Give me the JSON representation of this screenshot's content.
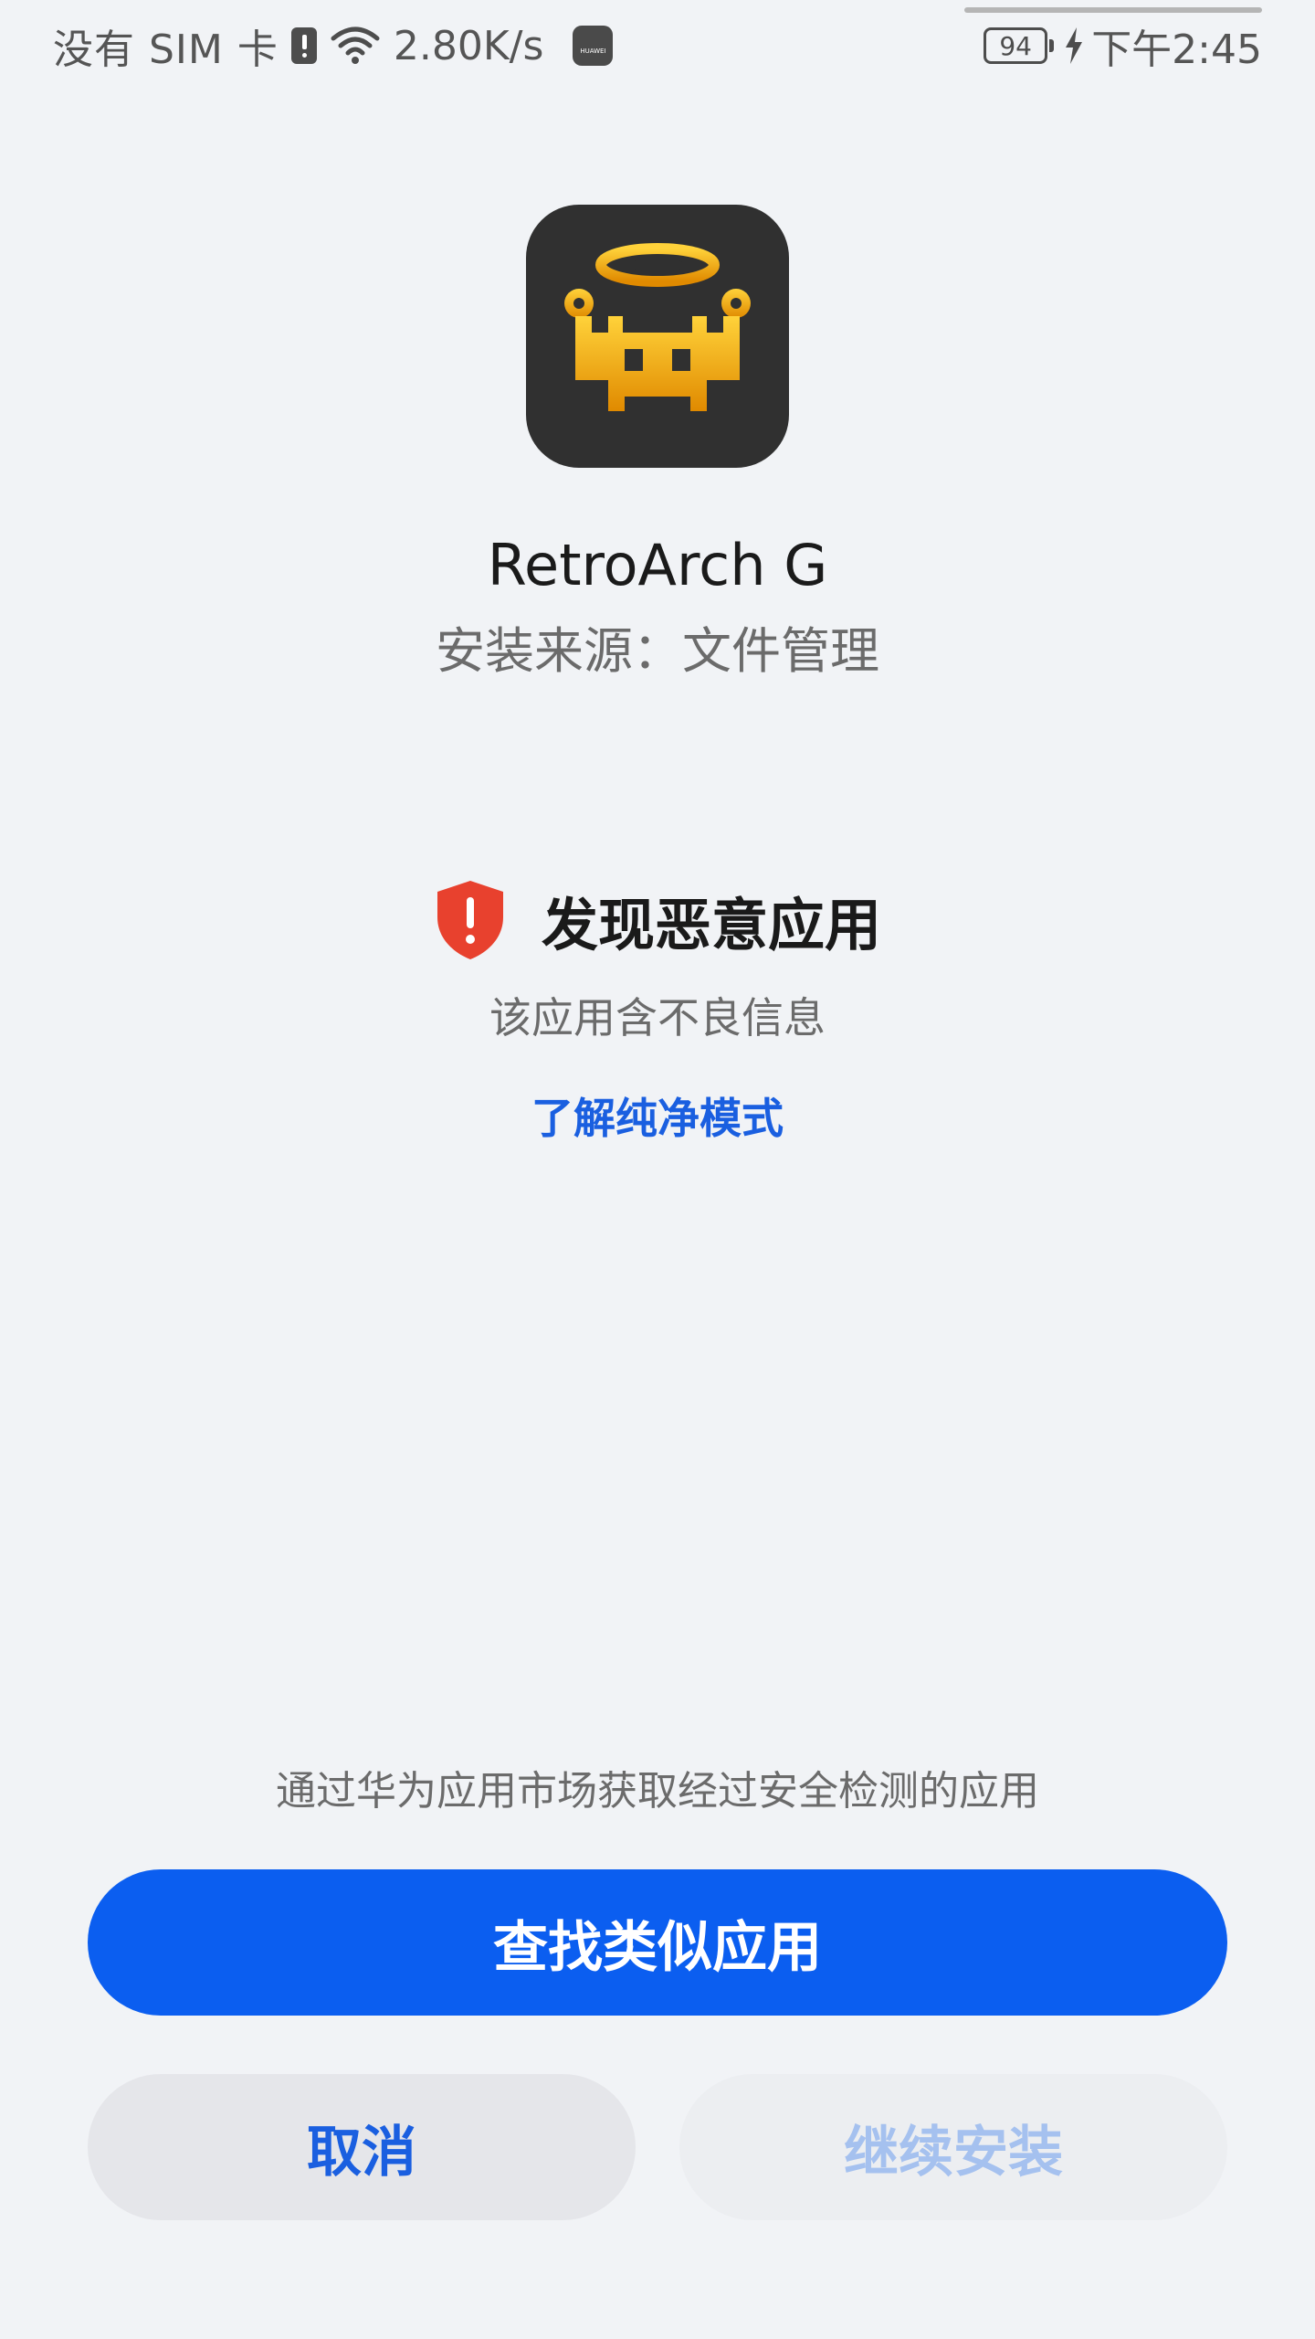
{
  "status_bar": {
    "carrier": "没有 SIM 卡",
    "network_speed": "2.80K/s",
    "battery_level": "94",
    "time": "下午2:45",
    "icons": [
      "sim-alert-icon",
      "wifi-icon",
      "huawei-icon",
      "battery-icon",
      "charging-icon"
    ]
  },
  "app": {
    "name": "RetroArch G",
    "install_source": "安装来源：文件管理",
    "icon": "retroarch-app-icon"
  },
  "warning": {
    "title": "发现恶意应用",
    "description": "该应用含不良信息",
    "link": "了解纯净模式",
    "icon": "shield-warning-icon",
    "icon_color": "#e8412e"
  },
  "footer": {
    "hint": "通过华为应用市场获取经过安全检测的应用",
    "primary_button": "查找类似应用",
    "cancel_button": "取消",
    "continue_button": "继续安装"
  },
  "colors": {
    "background": "#f1f3f6",
    "accent": "#0b5ef0",
    "link": "#1a5fe0",
    "danger": "#e8412e"
  }
}
